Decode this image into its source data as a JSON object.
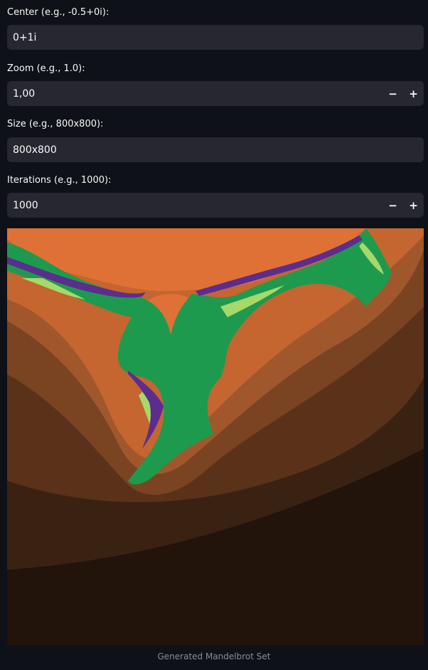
{
  "form": {
    "center": {
      "label": "Center (e.g., -0.5+0i):",
      "value": "0+1i"
    },
    "zoom": {
      "label": "Zoom (e.g., 1.0):",
      "value": "1,00",
      "minus": "−",
      "plus": "+"
    },
    "size": {
      "label": "Size (e.g., 800x800):",
      "value": "800x800"
    },
    "iterations": {
      "label": "Iterations (e.g., 1000):",
      "value": "1000",
      "minus": "−",
      "plus": "+"
    }
  },
  "image": {
    "caption": "Generated Mandelbrot Set"
  },
  "colors": {
    "background": "#0e1117",
    "input_bg": "#262730",
    "fractal_orange": "#e07136",
    "fractal_green": "#1e9a4e",
    "fractal_purple": "#5b2d8e"
  }
}
